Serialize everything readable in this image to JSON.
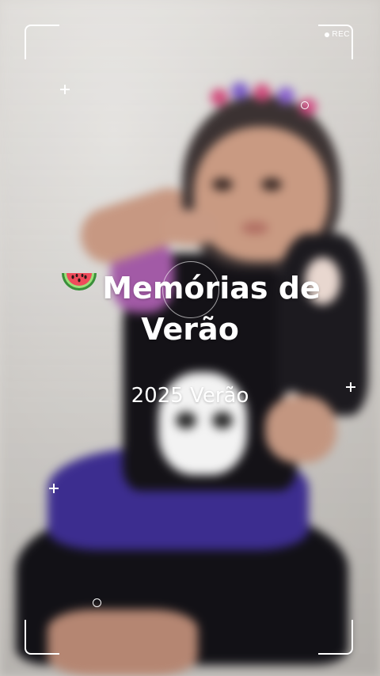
{
  "status": {
    "rec_label": "REC"
  },
  "overlay": {
    "title_line1": "Memórias de",
    "title_line2": "Verão",
    "title_icon": "watermelon-icon",
    "subtitle": "2025 Verão"
  },
  "colors": {
    "overlay_text": "#ffffff"
  }
}
